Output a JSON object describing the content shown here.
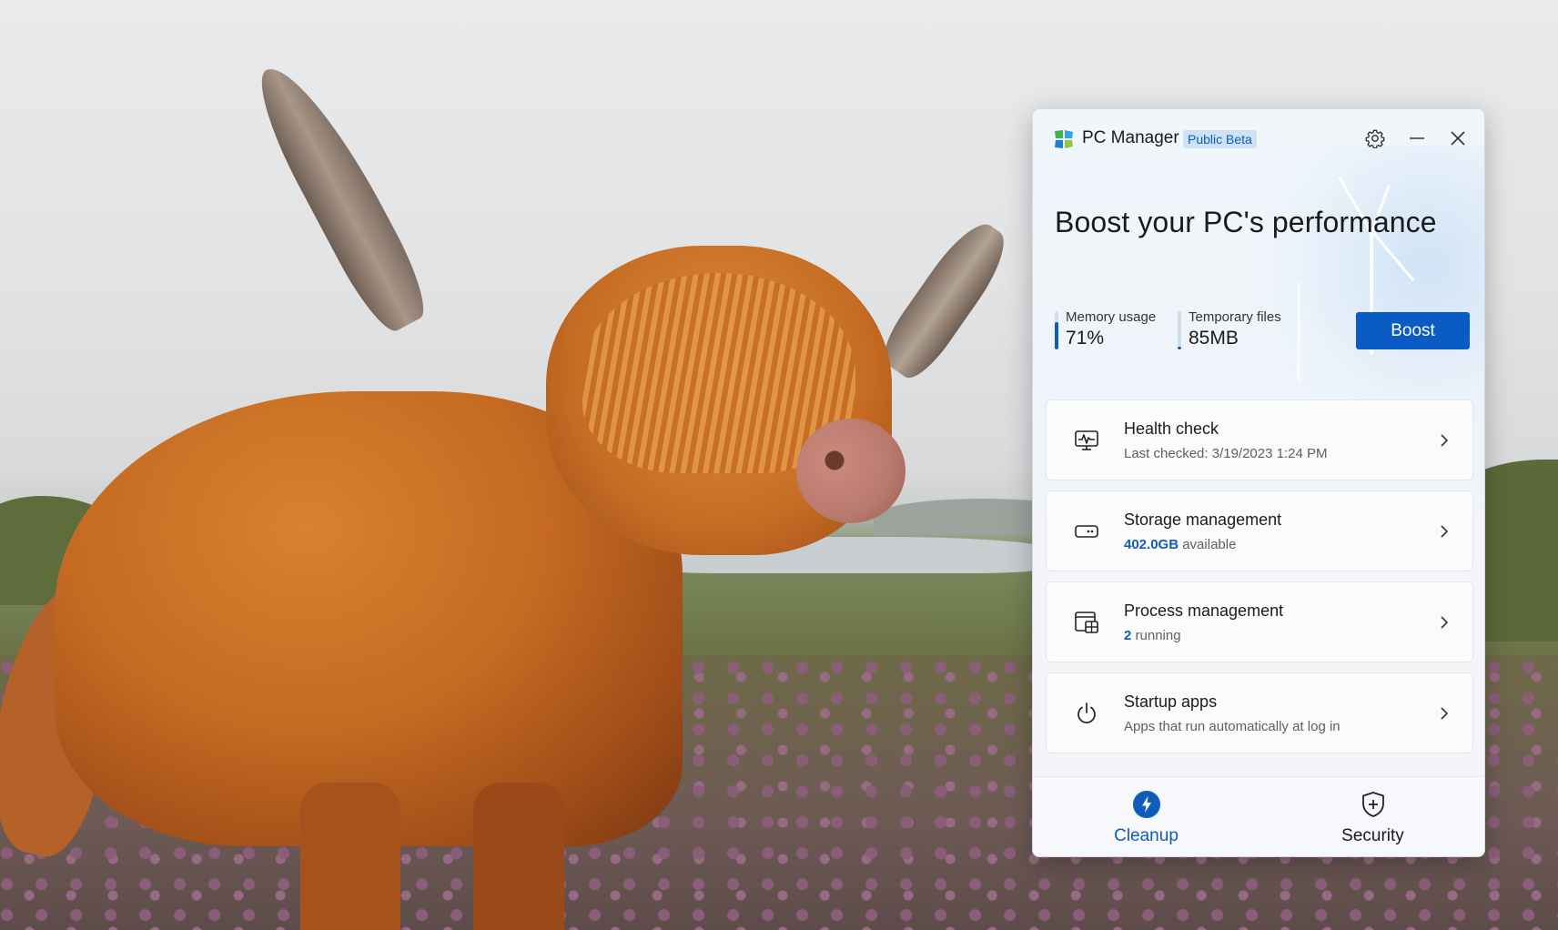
{
  "window": {
    "app_title": "PC Manager",
    "beta_badge": "Public Beta",
    "icons": {
      "settings": "gear-icon",
      "minimize": "minimize-icon",
      "close": "close-icon"
    }
  },
  "hero": {
    "title": "Boost your PC's performance",
    "memory": {
      "label": "Memory usage",
      "value": "71%",
      "level_percent": 71
    },
    "temp_files": {
      "label": "Temporary files",
      "value": "85MB"
    },
    "boost_label": "Boost"
  },
  "cards": [
    {
      "title": "Health check",
      "subtitle": "Last checked: 3/19/2023 1:24 PM",
      "icon": "heart-monitor-icon"
    },
    {
      "title": "Storage management",
      "accent": "402.0GB",
      "subtitle": " available",
      "icon": "drive-icon"
    },
    {
      "title": "Process management",
      "accent": "2",
      "subtitle": " running",
      "icon": "process-window-icon"
    },
    {
      "title": "Startup apps",
      "subtitle": "Apps that run automatically at log in",
      "icon": "power-icon"
    }
  ],
  "bottom_nav": [
    {
      "label": "Cleanup",
      "icon": "lightning-icon",
      "active": true
    },
    {
      "label": "Security",
      "icon": "shield-plus-icon",
      "active": false
    }
  ],
  "colors": {
    "accent": "#0f5cba",
    "boost_button": "#0a5bc4",
    "badge_bg": "#cfe1f5"
  }
}
